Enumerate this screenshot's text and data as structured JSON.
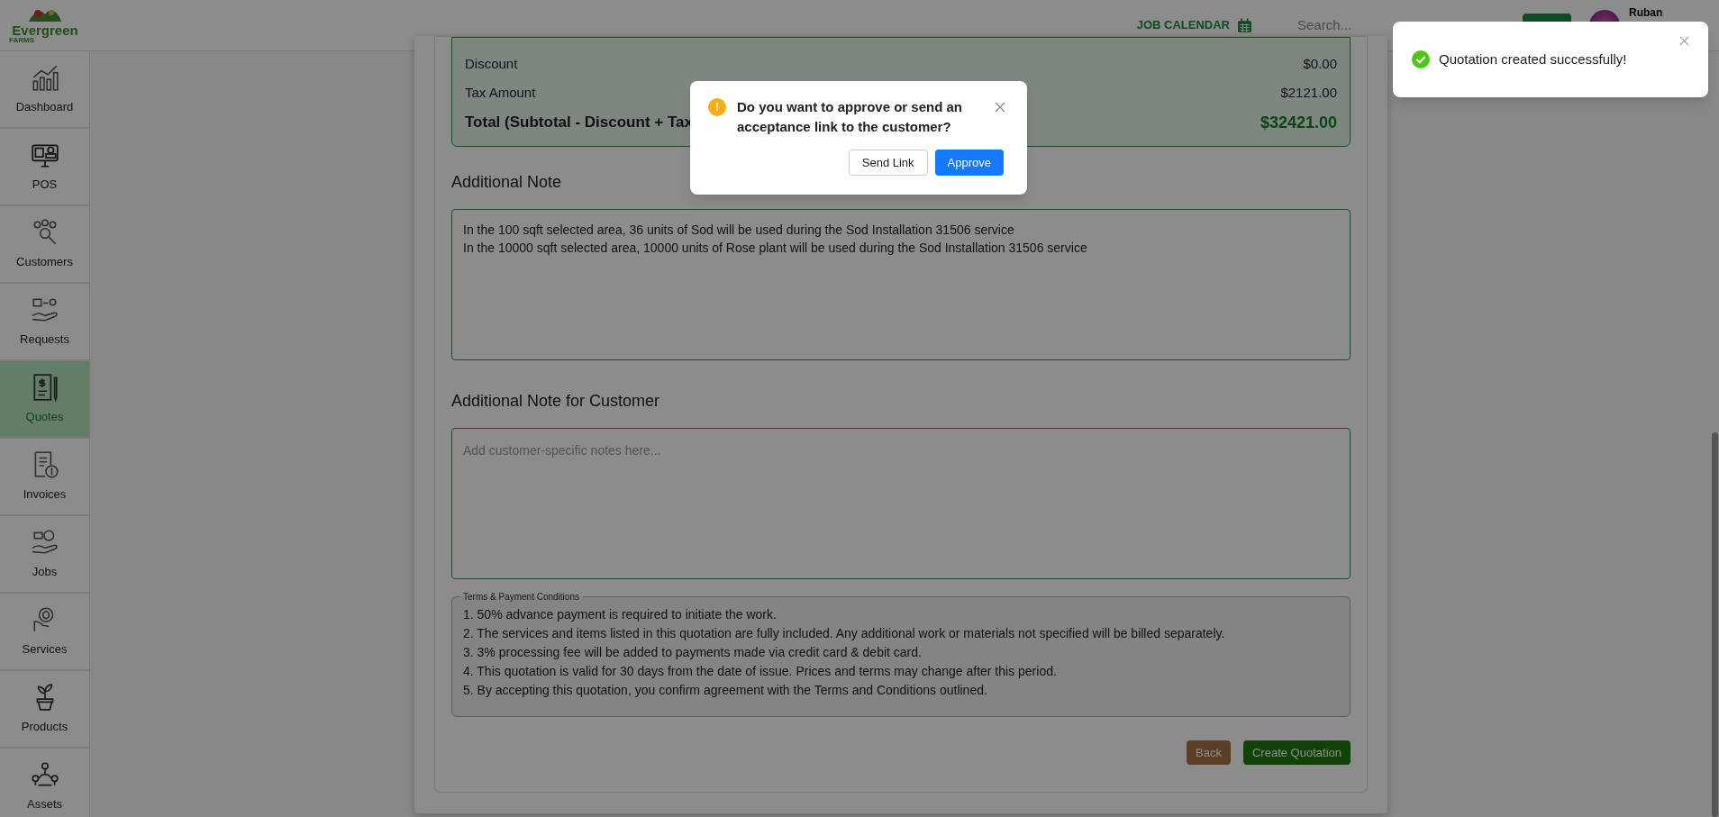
{
  "header": {
    "logo_text": "Evergreen",
    "logo_sub": "FARMS",
    "calendar_link": "JOB CALENDAR",
    "search": {
      "placeholder": "Search..."
    },
    "user_name": "Ruban"
  },
  "sidebar": {
    "items": [
      {
        "label": "Dashboard",
        "selected": false
      },
      {
        "label": "POS",
        "selected": false
      },
      {
        "label": "Customers",
        "selected": false
      },
      {
        "label": "Requests",
        "selected": false
      },
      {
        "label": "Quotes",
        "selected": true
      },
      {
        "label": "Invoices",
        "selected": false
      },
      {
        "label": "Jobs",
        "selected": false
      },
      {
        "label": "Services",
        "selected": false
      },
      {
        "label": "Products",
        "selected": false
      },
      {
        "label": "Assets",
        "selected": false
      }
    ]
  },
  "summary": {
    "rows": [
      {
        "label": "Discount",
        "value": "$0.00"
      },
      {
        "label": "Tax Amount",
        "value": "$2121.00"
      }
    ],
    "total": {
      "label": "Total (Subtotal - Discount + Tax",
      "value": "$32421.00"
    }
  },
  "additional_note": {
    "heading": "Additional Note",
    "value": "In the 100 sqft selected area, 36 units of Sod will be used during the Sod Installation 31506 service\nIn the 10000 sqft selected area, 10000 units of Rose plant will be used during the Sod Installation 31506 service"
  },
  "customer_note": {
    "heading": "Additional Note for Customer",
    "placeholder": "Add customer-specific notes here..."
  },
  "terms": {
    "legend": "Terms & Payment Conditions",
    "lines": [
      "1. 50% advance payment is required to initiate the work.",
      "2. The services and items listed in this quotation are fully included. Any additional work or materials not specified will be billed separately.",
      "3. 3% processing fee will be added to payments made via credit card & debit card.",
      "4. This quotation is valid for 30 days from the date of issue. Prices and terms may change after this period.",
      "5. By accepting this quotation, you confirm agreement with the Terms and Conditions outlined."
    ]
  },
  "buttons": {
    "back": "Back",
    "create": "Create Quotation"
  },
  "dialog": {
    "icon": "!",
    "message": "Do you want to approve or send an acceptance link to the customer?",
    "secondary": "Send Link",
    "primary": "Approve"
  },
  "toast": {
    "message": "Quotation created successfully!"
  }
}
